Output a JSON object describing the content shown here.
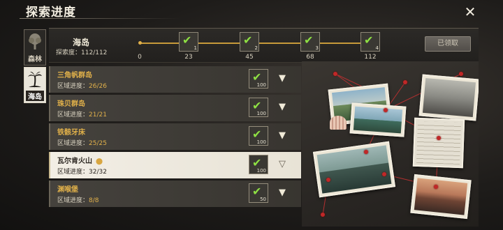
{
  "header": {
    "title": "探索进度",
    "close_icon": "close-icon"
  },
  "side_tabs": [
    {
      "label": "森林",
      "icon": "tree-icon",
      "active": false
    },
    {
      "label": "海岛",
      "icon": "palm-tree-icon",
      "active": true
    }
  ],
  "region": {
    "name": "海岛",
    "progress_label": "探索度：",
    "progress_value": "112/112",
    "milestones": [
      {
        "value": "0"
      },
      {
        "value": "23",
        "index": "1"
      },
      {
        "value": "45",
        "index": "2"
      },
      {
        "value": "68",
        "index": "3"
      },
      {
        "value": "112",
        "index": "4"
      }
    ],
    "claim_button": "已领取"
  },
  "areas": [
    {
      "name": "三角帆群岛",
      "progress_label": "区域进度：",
      "progress": "26/26",
      "reward": "100",
      "selected": false
    },
    {
      "name": "珠贝群岛",
      "progress_label": "区域进度：",
      "progress": "21/21",
      "reward": "100",
      "selected": false
    },
    {
      "name": "铁骸牙床",
      "progress_label": "区域进度：",
      "progress": "25/25",
      "reward": "100",
      "selected": false
    },
    {
      "name": "瓦尔肯火山",
      "progress_label": "区域进度：",
      "progress": "32/32",
      "reward": "100",
      "selected": true
    },
    {
      "name": "渊喉堡",
      "progress_label": "区域进度：",
      "progress": "8/8",
      "reward": "50",
      "selected": false
    }
  ],
  "colors": {
    "accent": "#e0b04a",
    "check": "#8ee043",
    "pin": "#c02828"
  }
}
